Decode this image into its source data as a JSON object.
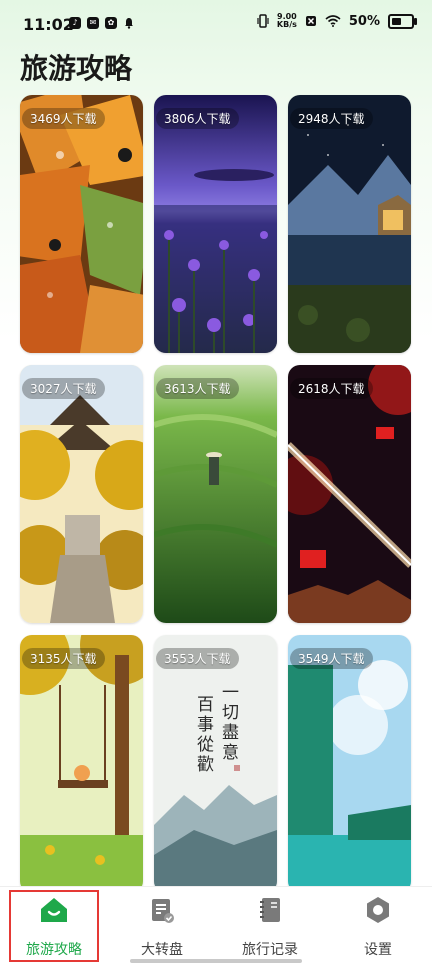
{
  "status": {
    "time": "11:02",
    "net_speed_top": "9.00",
    "net_speed_bottom": "KB/s",
    "battery": "50%",
    "battery_level": 0.5
  },
  "page": {
    "title": "旅游攻略"
  },
  "cards": [
    {
      "downloads": "3469人下载"
    },
    {
      "downloads": "3806人下载"
    },
    {
      "downloads": "2948人下载"
    },
    {
      "downloads": "3027人下载"
    },
    {
      "downloads": "3613人下载"
    },
    {
      "downloads": "2618人下载"
    },
    {
      "downloads": "3135人下载"
    },
    {
      "downloads": "3553人下载"
    },
    {
      "downloads": "3549人下载"
    }
  ],
  "card_art": {
    "poem_line1": "一切盡意",
    "poem_line2": "百事從歡"
  },
  "nav": {
    "items": [
      {
        "label": "旅游攻略",
        "icon": "home-icon"
      },
      {
        "label": "大转盘",
        "icon": "note-icon"
      },
      {
        "label": "旅行记录",
        "icon": "notebook-icon"
      },
      {
        "label": "设置",
        "icon": "settings-icon"
      }
    ],
    "active_color": "#1ea84a",
    "inactive_color": "#444444"
  }
}
